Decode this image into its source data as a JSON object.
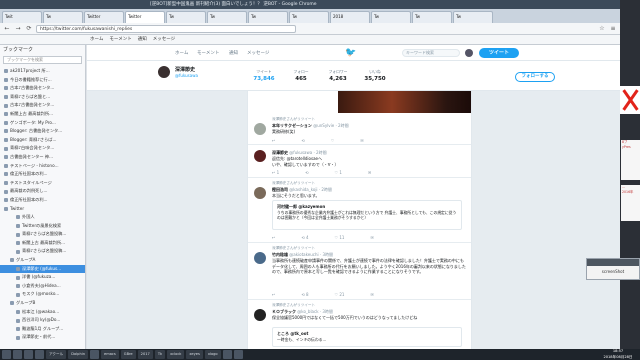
{
  "browser": {
    "window_title": "[逆BOT]新型中国鬼画 新刊紹介(3) 面白いでしょう！？ 逆BOT - Google Chrome",
    "tabs": [
      "Twit",
      "Tw",
      "Twitter",
      "Twitter",
      "Tw",
      "Tw",
      "Tw",
      "Tw",
      "2018",
      "Tw",
      "Tw",
      "Tw"
    ],
    "url": "https://twitter.com/fukusawanishi_replies",
    "bookmarks": [
      "ホーム",
      "モーメント",
      "通知",
      "メッセージ"
    ]
  },
  "sidebar": {
    "title": "ブックマーク",
    "search_placeholder": "ブックマークを検索",
    "items": [
      "ak2017project 所...",
      "今日の書籍推荐に行...",
      "古本♪古書曲発センタ...",
      "青柳♪さらば名盤と...",
      "古本♪古書曲発センタ...",
      "新聞上古 最高裁判所...",
      "ゲンゴポータ: My Pro...",
      "Blogger: 古書曲発センタ...",
      "Blogger: 青柳♪さらば...",
      "青柳♪白味会発センタ...",
      "古書曲発センター 神...",
      "テストページ - histono...",
      "倫正所社国本の利...",
      "テストスタイルページ",
      "最高裁の判例死し...",
      "倫正所社国本の利...",
      "Twitter",
      "外国人",
      "Twitterの風景化検索",
      "青柳♪さらば名盤投稿...",
      "新聞上古 最高裁判所...",
      "青柳♪さらば名盤投稿...",
      "グループA",
      "深澤節史 (@fukus...",
      "洋書 (@fukuza...",
      "小倉秀夫(@Hidea...",
      "モスク (@mosko...",
      "グループB",
      "松本江 (@wakao...",
      "西谷洋司 ky(@Do...",
      "難波龍1月 グループ...",
      "深澤節史・前代..."
    ],
    "selected_index": 23
  },
  "twitter_nav": {
    "home": "ホーム",
    "moments": "モーメント",
    "notifications": "通知",
    "messages": "メッセージ",
    "search_placeholder": "キーワード検索",
    "tweet_button": "ツイート"
  },
  "profile": {
    "name": "深澤節史",
    "handle": "@fukusawa",
    "stats": [
      {
        "label": "ツイート",
        "value": "73,846"
      },
      {
        "label": "フォロー",
        "value": "465"
      },
      {
        "label": "フォロワー",
        "value": "4,263"
      },
      {
        "label": "いいね",
        "value": "35,750"
      }
    ],
    "follow_button": "フォローする"
  },
  "tweets": [
    {
      "rt": "深澤節史さんがリツイート",
      "name": "本年リサクゼーション",
      "handle": "@unSylvie · 2時間",
      "text": "実務研修(笑)",
      "actions": [
        "↩",
        "⟲",
        "♡",
        "✉"
      ]
    },
    {
      "rt": "",
      "name": "深澤節史",
      "handle": "@fukusawa · 2時間",
      "text": "返信先: @tarotelldiosaeへ\nいや、確認していますので（・∀・）",
      "actions": [
        "↩ 1",
        "⟲",
        "♡ 1",
        "✉"
      ]
    },
    {
      "rt": "深澤節史さんがリツイート",
      "name": "樫田浩司",
      "handle": "@kashida_koji · 2時間",
      "text": "本当にそうだと思います。",
      "quote_name": "河村健一郎 @kazyemon",
      "quote_text": "うちの事務所の優秀な企業内弁護士がこれは無理だという方で\n弁護士、事務所としても、この規定に従うのは困難かと（今回は全弁護士業務がそうするかと）",
      "actions": [
        "↩",
        "⟲ 4",
        "♡ 11",
        "✉"
      ]
    },
    {
      "rt": "深澤節史さんがリツイート",
      "name": "竹内稔雄",
      "handle": "@akiotakeuchi · 3時間",
      "text": "当事務所も連続破産申請事件の関係で、弁護士が連続で事件の法律を確認しました！弁護士で実務の中にもデータ化して、周囲の人も事務所の代行をお願いしました。ようやく2016年の審判以来の状態になりましたので、事務所内で原本と写し一覧を確認できるように作業することになりそうです。",
      "actions": [
        "↩",
        "⟲ 8",
        "♡ 21",
        "✉"
      ]
    },
    {
      "rt": "深澤節史さんがリツイート",
      "name": "ＫＯブラック",
      "handle": "@ko_black · 3時間",
      "text": "保全協議官5000円ではなくて一括で500万円でいうのはどうなってましたけどね",
      "quote_name": "ところ @tk_oot",
      "quote_text": "一時金も、インキの伝わる…",
      "actions": []
    }
  ],
  "desktop": {
    "popup_title": "",
    "popup_text": "screenShot",
    "side_cards": [
      "8ブ",
      "yPres",
      "...",
      "2016年"
    ]
  },
  "taskbar": {
    "items": [
      "",
      "",
      "",
      "",
      "アクール",
      "Dolphin",
      "",
      "emacs",
      "GBre",
      "2017",
      "Tk",
      "xclock",
      "xeyes",
      "xlogo",
      "",
      ""
    ],
    "clock_time": "18:57",
    "clock_date": "2018年08月28日"
  }
}
